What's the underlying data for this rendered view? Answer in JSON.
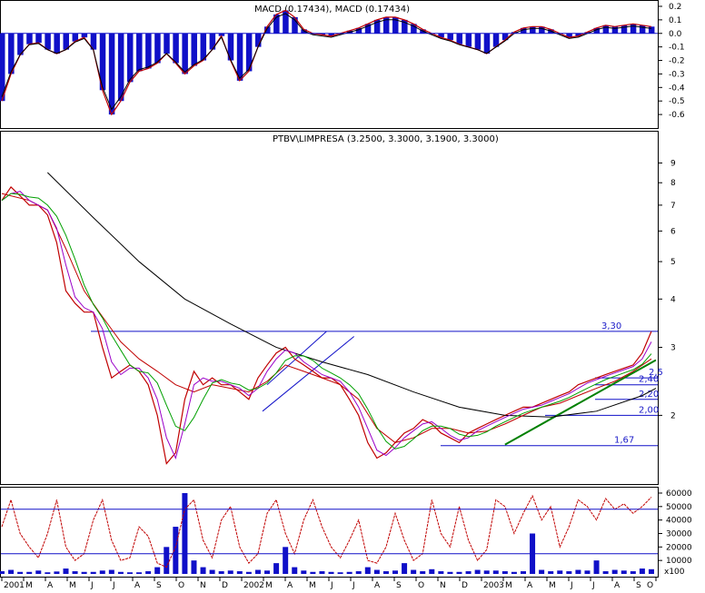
{
  "chart_data": [
    {
      "type": "bar",
      "panel": "macd",
      "title": "MACD (0.17434), MACD (0.17434)",
      "y_ticks": [
        "0.2",
        "0.1",
        "0.0",
        "-0.1",
        "-0.2",
        "-0.3",
        "-0.4",
        "-0.5",
        "-0.6"
      ],
      "ylim": [
        -0.68,
        0.22
      ],
      "grid": false,
      "colors": {
        "histogram": "#1010c8",
        "macd_line": "#c00000",
        "signal_line": "#000000"
      },
      "series": [
        {
          "name": "MACD",
          "x": [
            0,
            2,
            4,
            6,
            8,
            10,
            12,
            14,
            16,
            18,
            20,
            22,
            24,
            26,
            28,
            30,
            32,
            34,
            36,
            38,
            40,
            42,
            44,
            46,
            48,
            50,
            52,
            54,
            56,
            58,
            60,
            62,
            64,
            66,
            68,
            70,
            72,
            74,
            76,
            78,
            80,
            82,
            84,
            86,
            88,
            90,
            92,
            94,
            96,
            98,
            100,
            102,
            104,
            106,
            108,
            110,
            112,
            114,
            116,
            118,
            120,
            122,
            124,
            126,
            128,
            130,
            132,
            134,
            136,
            138,
            140,
            142
          ],
          "values": [
            -0.5,
            -0.3,
            -0.16,
            -0.08,
            -0.07,
            -0.12,
            -0.15,
            -0.12,
            -0.06,
            -0.03,
            -0.12,
            -0.42,
            -0.6,
            -0.5,
            -0.36,
            -0.28,
            -0.26,
            -0.22,
            -0.15,
            -0.22,
            -0.3,
            -0.24,
            -0.2,
            -0.12,
            -0.02,
            -0.2,
            -0.35,
            -0.28,
            -0.1,
            0.05,
            0.14,
            0.17,
            0.12,
            0.03,
            0.0,
            -0.01,
            -0.02,
            0.0,
            0.02,
            0.04,
            0.07,
            0.1,
            0.12,
            0.12,
            0.1,
            0.07,
            0.03,
            0.0,
            -0.03,
            -0.05,
            -0.08,
            -0.1,
            -0.12,
            -0.15,
            -0.1,
            -0.05,
            0.01,
            0.04,
            0.05,
            0.05,
            0.03,
            0.0,
            -0.03,
            -0.02,
            0.01,
            0.04,
            0.06,
            0.05,
            0.06,
            0.07,
            0.06,
            0.05
          ]
        }
      ]
    },
    {
      "type": "line",
      "panel": "price",
      "title": "PTBV\\LIMPRESA (3.2500, 3.3000, 3.1900, 3.3000)",
      "scale": "log",
      "y_ticks": [
        "9",
        "8",
        "7",
        "6",
        "5",
        "4",
        "3",
        "2"
      ],
      "ylim": [
        1.35,
        10
      ],
      "colors": {
        "price": "#c00000",
        "ma_short": "#9a00c8",
        "ma_medium": "#00a000",
        "ma_long": "#c00000",
        "ma_200": "#000000",
        "lines": "#1010c8",
        "trend": "#008000"
      },
      "horizontal_levels": [
        {
          "value": 3.3,
          "label": "3,30"
        },
        {
          "value": 2.5,
          "label": "2,5"
        },
        {
          "value": 2.4,
          "label": "2,40"
        },
        {
          "value": 2.2,
          "label": "2,20"
        },
        {
          "value": 2.0,
          "label": "2,00"
        },
        {
          "value": 1.67,
          "label": "1,67"
        }
      ],
      "series": [
        {
          "name": "Price",
          "x": [
            0,
            2,
            4,
            6,
            8,
            10,
            12,
            14,
            16,
            18,
            20,
            22,
            24,
            26,
            28,
            30,
            32,
            34,
            36,
            38,
            40,
            42,
            44,
            46,
            48,
            50,
            52,
            54,
            56,
            58,
            60,
            62,
            64,
            66,
            68,
            70,
            72,
            74,
            76,
            78,
            80,
            82,
            84,
            86,
            88,
            90,
            92,
            94,
            96,
            98,
            100,
            102,
            104,
            106,
            108,
            110,
            112,
            114,
            116,
            118,
            120,
            122,
            124,
            126,
            128,
            130,
            132,
            134,
            136,
            138,
            140,
            142
          ],
          "values": [
            7.2,
            7.8,
            7.4,
            7.0,
            7.0,
            6.6,
            5.6,
            4.2,
            3.9,
            3.7,
            3.7,
            3.0,
            2.5,
            2.6,
            2.7,
            2.6,
            2.4,
            2.0,
            1.5,
            1.6,
            2.2,
            2.6,
            2.4,
            2.5,
            2.4,
            2.4,
            2.3,
            2.2,
            2.5,
            2.7,
            2.9,
            3.0,
            2.8,
            2.7,
            2.6,
            2.5,
            2.5,
            2.4,
            2.2,
            2.0,
            1.7,
            1.55,
            1.6,
            1.7,
            1.8,
            1.85,
            1.95,
            1.9,
            1.8,
            1.75,
            1.7,
            1.8,
            1.85,
            1.9,
            1.95,
            2.0,
            2.05,
            2.1,
            2.1,
            2.15,
            2.2,
            2.25,
            2.3,
            2.4,
            2.45,
            2.5,
            2.55,
            2.6,
            2.65,
            2.7,
            2.9,
            3.3
          ]
        },
        {
          "name": "MA200",
          "x": [
            10,
            20,
            30,
            40,
            50,
            60,
            70,
            80,
            90,
            100,
            110,
            120,
            130,
            140,
            143
          ],
          "values": [
            8.5,
            6.5,
            5.0,
            4.0,
            3.45,
            3.0,
            2.75,
            2.55,
            2.3,
            2.1,
            2.0,
            1.98,
            2.05,
            2.25,
            2.35
          ]
        },
        {
          "name": "MA long",
          "x": [
            0,
            6,
            10,
            14,
            18,
            22,
            26,
            30,
            34,
            38,
            42,
            46,
            50,
            54,
            58,
            62,
            66,
            70,
            74,
            78,
            82,
            86,
            90,
            94,
            98,
            102,
            106,
            110,
            114,
            118,
            122,
            126,
            130,
            134,
            138,
            142
          ],
          "values": [
            7.5,
            7.2,
            6.8,
            5.4,
            4.2,
            3.6,
            3.1,
            2.8,
            2.6,
            2.4,
            2.3,
            2.4,
            2.35,
            2.3,
            2.45,
            2.7,
            2.6,
            2.5,
            2.4,
            2.2,
            1.85,
            1.7,
            1.75,
            1.85,
            1.85,
            1.8,
            1.82,
            1.9,
            2.0,
            2.1,
            2.15,
            2.25,
            2.35,
            2.45,
            2.6,
            2.8
          ]
        }
      ]
    },
    {
      "type": "bar",
      "panel": "volume",
      "y_ticks": [
        "60000",
        "50000",
        "40000",
        "30000",
        "20000",
        "10000"
      ],
      "ylim": [
        0,
        62000
      ],
      "unit_label": "x100",
      "horizontal_levels": [
        48000,
        15000
      ],
      "x_ticks": [
        "2001",
        "M",
        "A",
        "M",
        "J",
        "J",
        "A",
        "S",
        "O",
        "N",
        "D",
        "2002",
        "M",
        "A",
        "M",
        "J",
        "J",
        "A",
        "S",
        "O",
        "N",
        "D",
        "2003",
        "M",
        "A",
        "M",
        "J",
        "J",
        "A",
        "S",
        "O"
      ],
      "colors": {
        "volume": "#1010c8",
        "oscillator": "#c00000",
        "levels": "#1010c8"
      },
      "series": [
        {
          "name": "Volume",
          "x": [
            0,
            2,
            4,
            6,
            8,
            10,
            12,
            14,
            16,
            18,
            20,
            22,
            24,
            26,
            28,
            30,
            32,
            34,
            36,
            38,
            40,
            42,
            44,
            46,
            48,
            50,
            52,
            54,
            56,
            58,
            60,
            62,
            64,
            66,
            68,
            70,
            72,
            74,
            76,
            78,
            80,
            82,
            84,
            86,
            88,
            90,
            92,
            94,
            96,
            98,
            100,
            102,
            104,
            106,
            108,
            110,
            112,
            114,
            116,
            118,
            120,
            122,
            124,
            126,
            128,
            130,
            132,
            134,
            136,
            138,
            140,
            142
          ],
          "values": [
            2000,
            3000,
            1500,
            1500,
            2500,
            1200,
            1800,
            4000,
            2000,
            1500,
            1500,
            2500,
            3000,
            1500,
            1200,
            1200,
            2000,
            5000,
            20000,
            35000,
            60000,
            10000,
            5000,
            3000,
            2000,
            2500,
            2000,
            1500,
            3000,
            2500,
            8000,
            20000,
            5000,
            2500,
            1500,
            2000,
            1500,
            1200,
            1500,
            2000,
            5000,
            3000,
            2000,
            2500,
            8000,
            3000,
            2000,
            3500,
            2000,
            1500,
            1500,
            2000,
            3000,
            2500,
            2500,
            2000,
            1500,
            2000,
            30000,
            3000,
            2000,
            2500,
            2000,
            3000,
            2500,
            10000,
            2000,
            3000,
            2500,
            2000,
            4000,
            3500
          ]
        },
        {
          "name": "Oscillator",
          "x": [
            0,
            2,
            4,
            6,
            8,
            10,
            12,
            14,
            16,
            18,
            20,
            22,
            24,
            26,
            28,
            30,
            32,
            34,
            36,
            38,
            40,
            42,
            44,
            46,
            48,
            50,
            52,
            54,
            56,
            58,
            60,
            62,
            64,
            66,
            68,
            70,
            72,
            74,
            76,
            78,
            80,
            82,
            84,
            86,
            88,
            90,
            92,
            94,
            96,
            98,
            100,
            102,
            104,
            106,
            108,
            110,
            112,
            114,
            116,
            118,
            120,
            122,
            124,
            126,
            128,
            130,
            132,
            134,
            136,
            138,
            140,
            142
          ],
          "values": [
            35000,
            55000,
            30000,
            20000,
            12000,
            30000,
            55000,
            20000,
            10000,
            15000,
            40000,
            55000,
            25000,
            10000,
            12000,
            35000,
            28000,
            8000,
            5000,
            20000,
            48000,
            55000,
            25000,
            12000,
            40000,
            50000,
            20000,
            8000,
            15000,
            45000,
            55000,
            30000,
            15000,
            40000,
            55000,
            35000,
            20000,
            12000,
            25000,
            40000,
            10000,
            8000,
            20000,
            45000,
            25000,
            10000,
            15000,
            55000,
            30000,
            20000,
            50000,
            25000,
            10000,
            18000,
            55000,
            50000,
            30000,
            45000,
            58000,
            40000,
            50000,
            20000,
            35000,
            55000,
            50000,
            40000,
            56000,
            48000,
            52000,
            45000,
            50000,
            57000
          ]
        }
      ]
    }
  ]
}
